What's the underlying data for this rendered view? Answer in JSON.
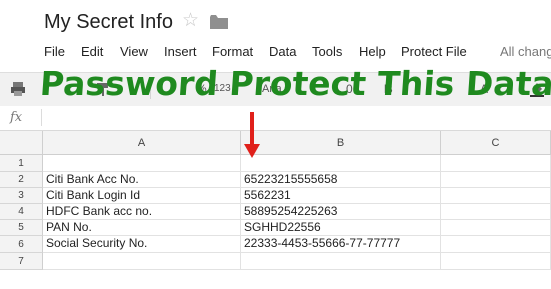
{
  "document": {
    "title": "My Secret Info"
  },
  "menu": {
    "items": [
      "File",
      "Edit",
      "View",
      "Insert",
      "Format",
      "Data",
      "Tools",
      "Help",
      "Protect File"
    ],
    "status_text": "All chang"
  },
  "toolbar": {
    "zoom_fragment": "123",
    "font_fragment": "Aria",
    "size_fragment": "0",
    "bold_label": "B",
    "font_color_label": "A"
  },
  "formula_bar": {
    "fx_label": "fx",
    "value": ""
  },
  "sheet": {
    "columns": [
      "A",
      "B",
      "C"
    ],
    "rows": [
      {
        "number": "1",
        "a": "",
        "b": ""
      },
      {
        "number": "2",
        "a": "Citi Bank Acc No.",
        "b": "65223215555658"
      },
      {
        "number": "3",
        "a": "Citi Bank Login Id",
        "b": "5562231"
      },
      {
        "number": "4",
        "a": "HDFC Bank acc no.",
        "b": "58895254225263"
      },
      {
        "number": "5",
        "a": "PAN No.",
        "b": "SGHHD22556"
      },
      {
        "number": "6",
        "a": "Social Security No.",
        "b": "22333-4453-55666-77-77777"
      },
      {
        "number": "7",
        "a": "",
        "b": ""
      }
    ]
  },
  "overlay": {
    "banner_text": "Password Protect This Data",
    "banner_color": "#1f8a1f",
    "arrow_color": "#e0201a"
  }
}
